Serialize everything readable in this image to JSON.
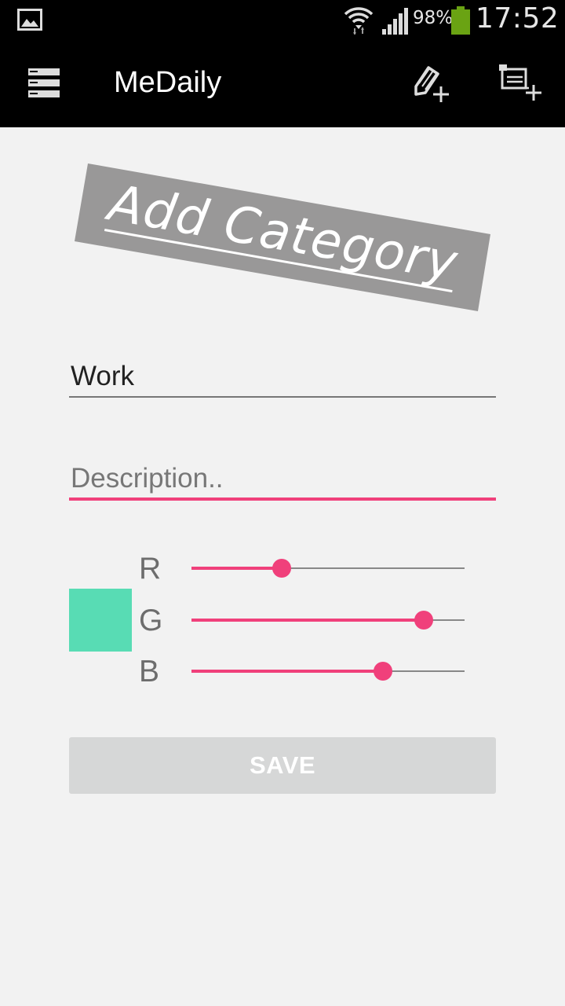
{
  "status_bar": {
    "battery_percent": "98%",
    "time": "17:52",
    "icons": [
      "gallery-icon",
      "wifi-icon",
      "signal-icon",
      "battery-icon"
    ]
  },
  "app_bar": {
    "title": "MeDaily",
    "icons": [
      "menu-icon",
      "add-note-icon",
      "add-category-icon"
    ]
  },
  "banner": {
    "text": "Add Category"
  },
  "form": {
    "name_value": "Work",
    "description_placeholder": "Description..",
    "description_value": "",
    "save_label": "SAVE"
  },
  "color_picker": {
    "preview_color": "#58dcb4",
    "sliders": [
      {
        "label": "R",
        "value": 0.33
      },
      {
        "label": "G",
        "value": 0.85
      },
      {
        "label": "B",
        "value": 0.7
      }
    ]
  },
  "colors": {
    "accent": "#f0407b",
    "app_bar": "#000000",
    "background": "#f2f2f2",
    "banner": "#999898"
  }
}
